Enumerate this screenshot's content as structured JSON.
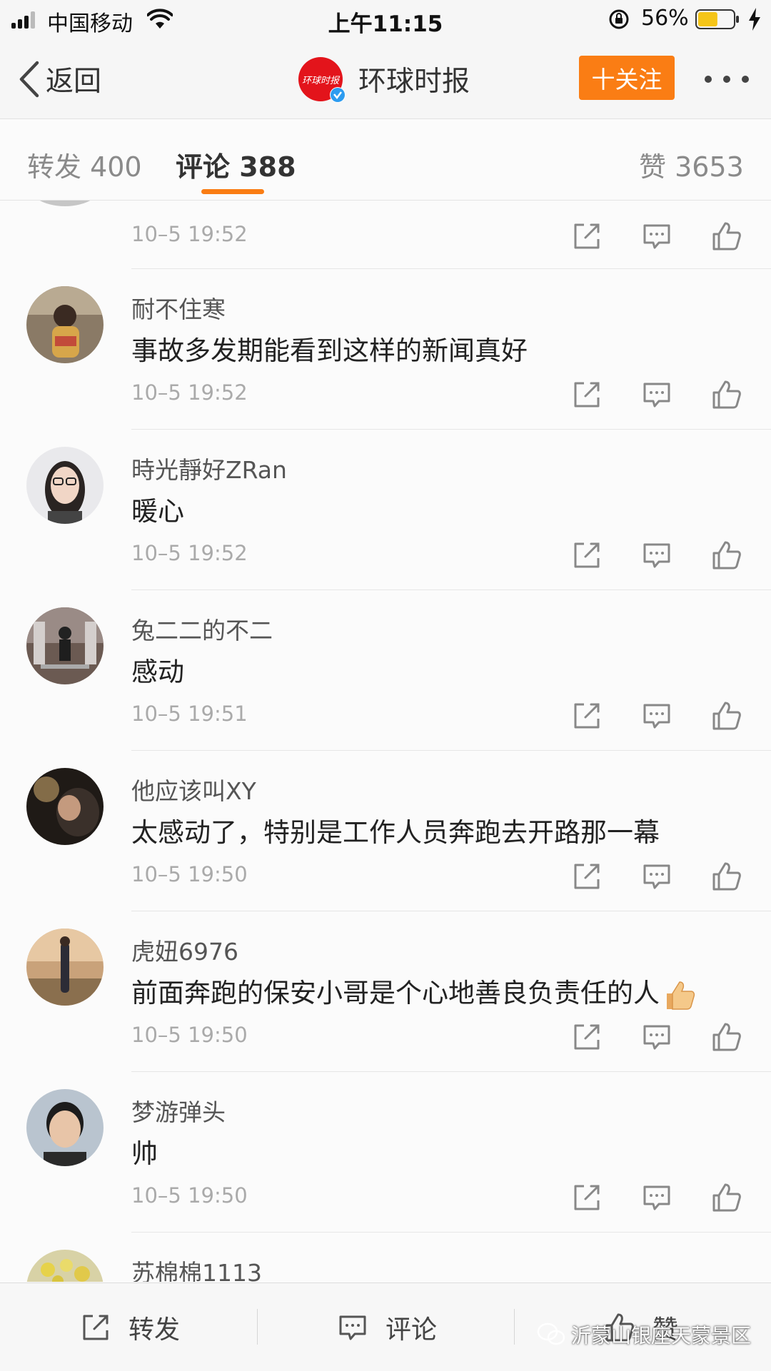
{
  "status_bar": {
    "carrier": "中国移动",
    "time": "上午11:15",
    "battery_percent": "56%",
    "battery_level": 0.56,
    "battery_color": "#f5c518"
  },
  "nav": {
    "back_label": "返回",
    "account_name": "环球时报",
    "logo_text": "环球时报",
    "follow_label": "十关注",
    "accent_color": "#fa7d14",
    "brand_color": "#e3141b"
  },
  "tabs": {
    "repost": "转发 400",
    "comment": "评论 388",
    "like": "赞 3653"
  },
  "comments": {
    "first_time": "10–5 19:52",
    "items": [
      {
        "user": "耐不住寒",
        "text": "事故多发期能看到这样的新闻真好",
        "time": "10–5 19:52"
      },
      {
        "user": "時光靜好ZRan",
        "text": "暖心",
        "time": "10–5 19:52"
      },
      {
        "user": "兔二二的不二",
        "text": "感动",
        "time": "10–5 19:51"
      },
      {
        "user": "他应该叫XY",
        "text": "太感动了，特别是工作人员奔跑去开路那一幕",
        "time": "10–5 19:50"
      },
      {
        "user": "虎妞6976",
        "text": "前面奔跑的保安小哥是个心地善良负责任的人",
        "time": "10–5 19:50"
      },
      {
        "user": "梦游弹头",
        "text": "帅",
        "time": "10–5 19:50"
      },
      {
        "user": "苏棉棉1113"
      }
    ]
  },
  "bottom_bar": {
    "repost_label": "转发",
    "comment_label": "评论",
    "like_label": "赞",
    "watermark": "沂蒙山银座天蒙景区"
  }
}
